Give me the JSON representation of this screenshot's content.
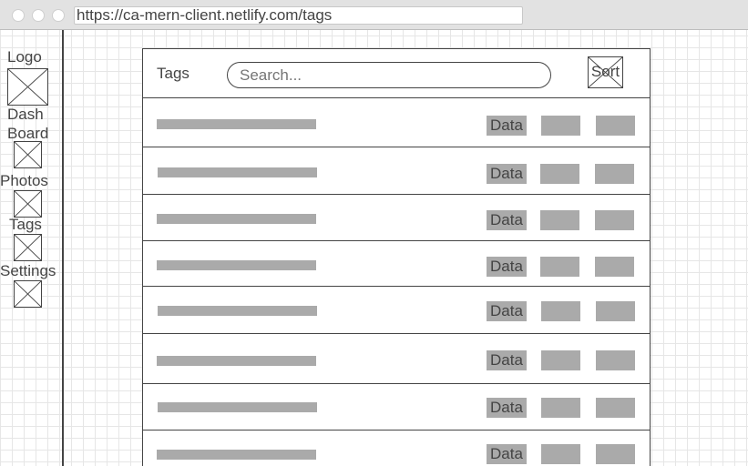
{
  "browser": {
    "url": "https://ca-mern-client.netlify.com/tags"
  },
  "sidebar": {
    "logo_label": "Logo",
    "items": [
      {
        "label": "Dash\nBoard"
      },
      {
        "label": "Photos"
      },
      {
        "label": "Tags"
      },
      {
        "label": "Settings"
      }
    ]
  },
  "main": {
    "title": "Tags",
    "search_placeholder": "Search...",
    "sort_label": "Sort",
    "rows": [
      {
        "data_label": "Data"
      },
      {
        "data_label": "Data"
      },
      {
        "data_label": "Data"
      },
      {
        "data_label": "Data"
      },
      {
        "data_label": "Data"
      },
      {
        "data_label": "Data"
      },
      {
        "data_label": "Data"
      },
      {
        "data_label": "Data"
      }
    ]
  },
  "colors": {
    "placeholder_fill": "#aaaaaa",
    "border": "#444444",
    "grid": "#e6e6e6"
  }
}
